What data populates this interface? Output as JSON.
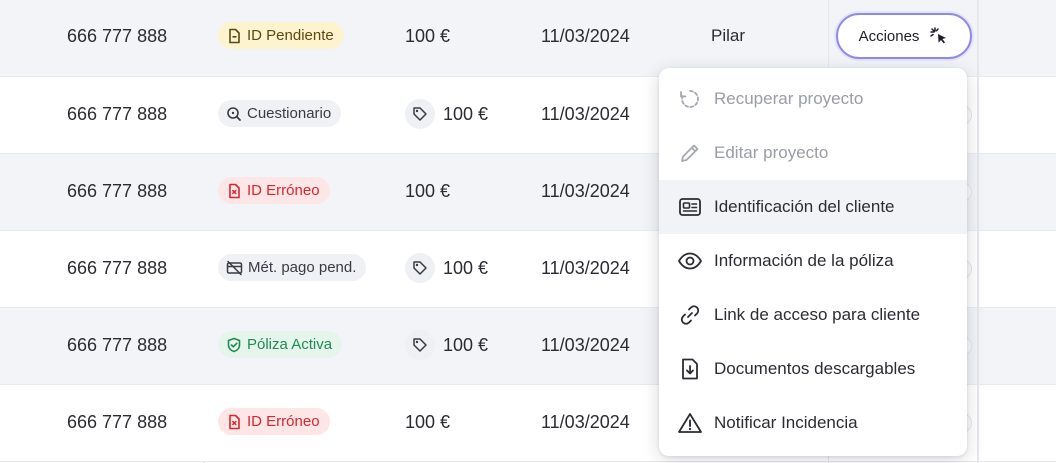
{
  "rows": [
    {
      "phone": "666 777 888",
      "badge": "ID Pendiente",
      "badge_color": "#fdf3cf",
      "amount": "100 €",
      "date": "11/03/2024",
      "name": "Pilar"
    },
    {
      "phone": "666 777 888",
      "badge": "Cuestionario",
      "badge_color": "#f0f1f4",
      "amount": "100 €",
      "date": "11/03/2024"
    },
    {
      "phone": "666 777 888",
      "badge": "ID Erróneo",
      "badge_color": "#fde6e6",
      "amount": "100 €",
      "date": "11/03/2024"
    },
    {
      "phone": "666 777 888",
      "badge": "Mét. pago pend.",
      "badge_color": "#f0f1f4",
      "amount": "100 €",
      "date": "11/03/2024"
    },
    {
      "phone": "666 777 888",
      "badge": "Póliza Activa",
      "badge_color": "#e5f5ec",
      "amount": "100 €",
      "date": "11/03/2024"
    },
    {
      "phone": "666 777 888",
      "badge": "ID Erróneo",
      "badge_color": "#fde6e6",
      "amount": "100 €",
      "date": "11/03/2024"
    }
  ],
  "actions_button": {
    "label": "Acciones",
    "icon": "sparkle-cursor-icon",
    "border_color": "#8f8ae8"
  },
  "menu": {
    "items": [
      {
        "label": "Recuperar proyecto",
        "icon": "recover-icon",
        "disabled": true
      },
      {
        "label": "Editar proyecto",
        "icon": "pencil-icon",
        "disabled": true
      },
      {
        "label": "Identificación del cliente",
        "icon": "id-card-icon",
        "highlighted": true
      },
      {
        "label": "Información de la póliza",
        "icon": "eye-icon"
      },
      {
        "label": "Link de acceso para cliente",
        "icon": "link-icon"
      },
      {
        "label": "Documentos descargables",
        "icon": "download-document-icon"
      },
      {
        "label": "Notificar Incidencia",
        "icon": "warning-icon"
      }
    ]
  }
}
